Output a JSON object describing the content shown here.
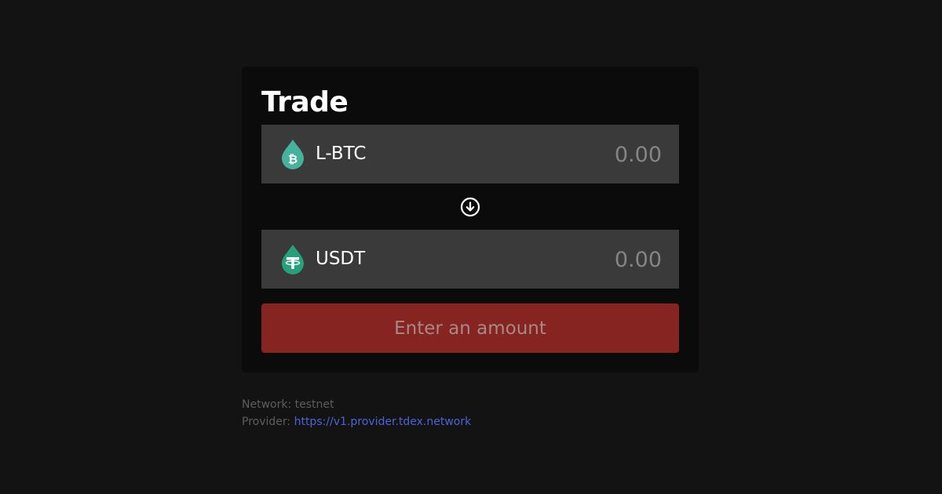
{
  "trade": {
    "title": "Trade",
    "from": {
      "asset": "L-BTC",
      "amount_placeholder": "0.00",
      "icon": "liquid-bitcoin-icon",
      "icon_color": "#46b19c"
    },
    "to": {
      "asset": "USDT",
      "amount_placeholder": "0.00",
      "icon": "tether-icon",
      "icon_color": "#26a17b"
    },
    "swap_icon": "arrow-down-circle-icon",
    "submit_label": "Enter an amount",
    "submit_color": "#852420"
  },
  "footer": {
    "network_label": "Network:",
    "network_value": "testnet",
    "provider_label": "Provider:",
    "provider_url": "https://v1.provider.tdex.network"
  }
}
